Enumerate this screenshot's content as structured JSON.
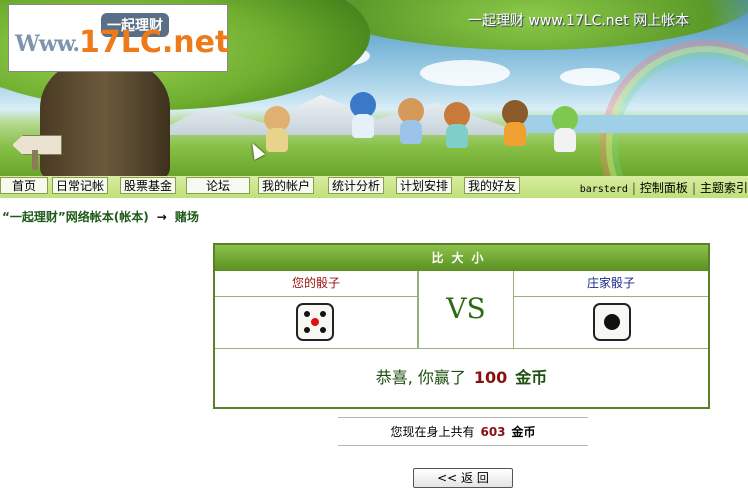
{
  "header": {
    "logo": {
      "bubble": "一起理财",
      "www": "Www.",
      "domain": "17LC.net"
    },
    "site_tag": "一起理财 www.17LC.net 网上帐本"
  },
  "nav": {
    "items": [
      "首页",
      "日常记帐",
      "股票基金",
      "论坛",
      "我的帐户",
      "统计分析",
      "计划安排",
      "我的好友"
    ],
    "user": "barsterd",
    "links": [
      "控制面板",
      "主题索引"
    ]
  },
  "breadcrumb": {
    "home": "“一起理财”网络帐本(帐本)",
    "arrow": "→",
    "current": "赌场"
  },
  "game": {
    "title": "比大小",
    "player_label": "您的骰子",
    "banker_label": "庄家骰子",
    "vs": "VS",
    "player_die": 5,
    "banker_die": 1,
    "result_prefix": "恭喜, 你赢了",
    "result_amount": "100",
    "result_unit": "金币",
    "player_label_color": "#9b1010",
    "banker_label_color": "#1a2a8c",
    "center_pip_color": "#e01010"
  },
  "balance": {
    "prefix": "您现在身上共有",
    "coins": "603",
    "unit": "金币"
  },
  "back_button": "<< 返 回"
}
